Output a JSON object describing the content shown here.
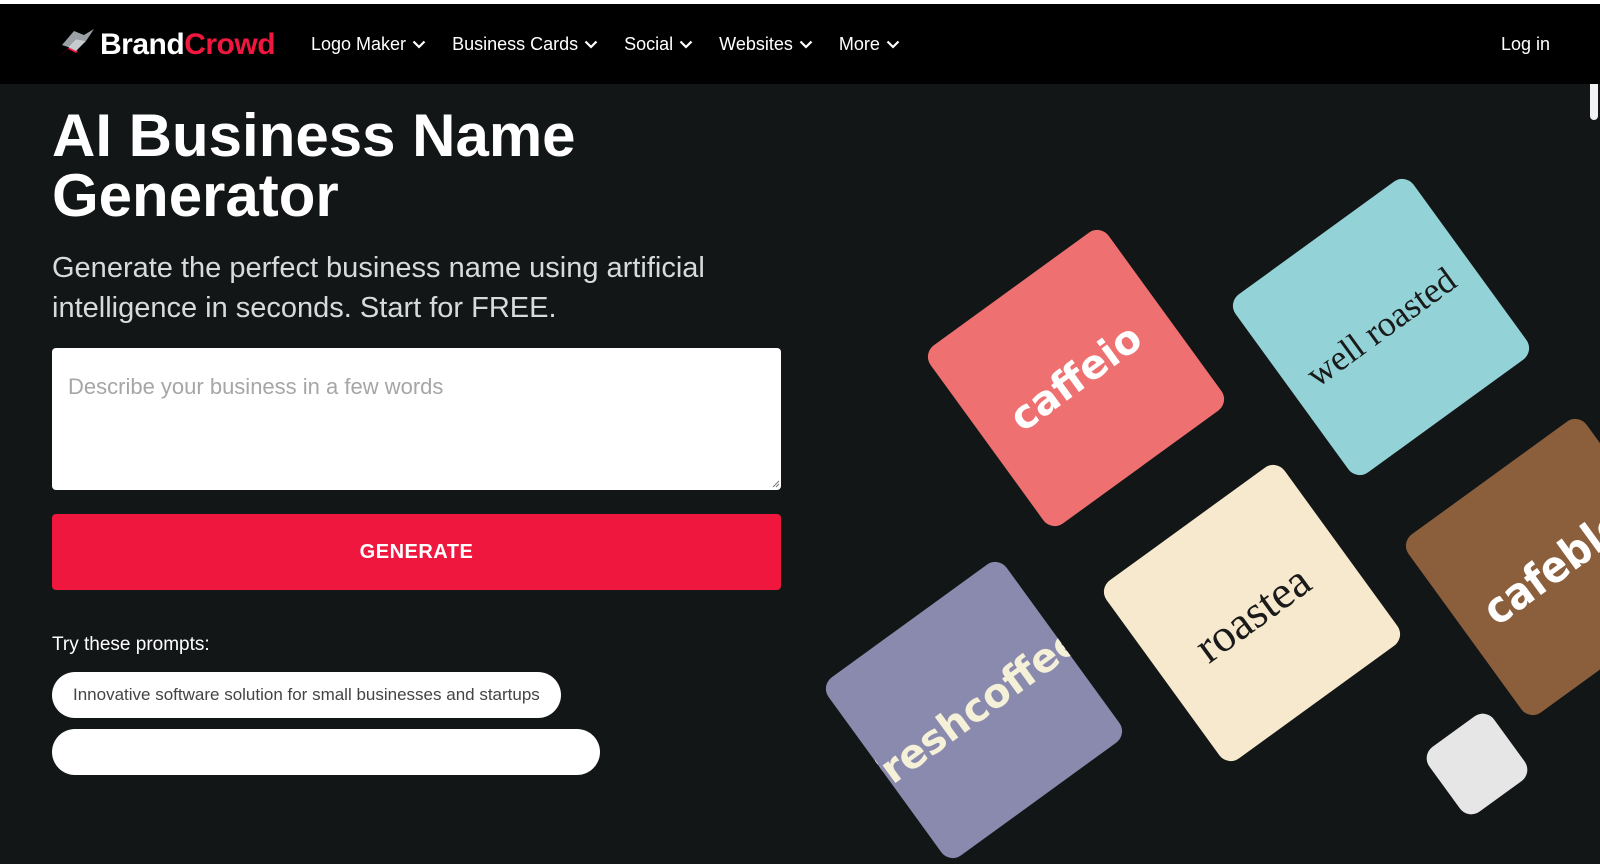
{
  "nav": {
    "brand_part1": "Brand",
    "brand_part2": "Crowd",
    "items": [
      {
        "label": "Logo Maker"
      },
      {
        "label": "Business Cards"
      },
      {
        "label": "Social"
      },
      {
        "label": "Websites"
      },
      {
        "label": "More"
      }
    ],
    "login": "Log in"
  },
  "hero": {
    "title": "AI Business Name Generator",
    "subtitle": "Generate the perfect business name using artificial intelligence in seconds. Start for FREE."
  },
  "form": {
    "placeholder": "Describe your business in a few words",
    "value": "",
    "generate_label": "GENERATE"
  },
  "prompts": {
    "label": "Try these prompts:",
    "items": [
      "Innovative software solution for small businesses and startups"
    ]
  },
  "showcase": {
    "cards": [
      {
        "name": "caffeio",
        "color": "#ee7070"
      },
      {
        "name": "well roasted",
        "color": "#93d3d7"
      },
      {
        "name": "roastea",
        "color": "#f7e9ce"
      },
      {
        "name": "cafeble",
        "color": "#8b5e3c"
      },
      {
        "name": "freshcoffee",
        "color": "#8a8aae"
      }
    ]
  },
  "colors": {
    "accent": "#f0173f",
    "background": "#131617",
    "navbar": "#000000"
  }
}
